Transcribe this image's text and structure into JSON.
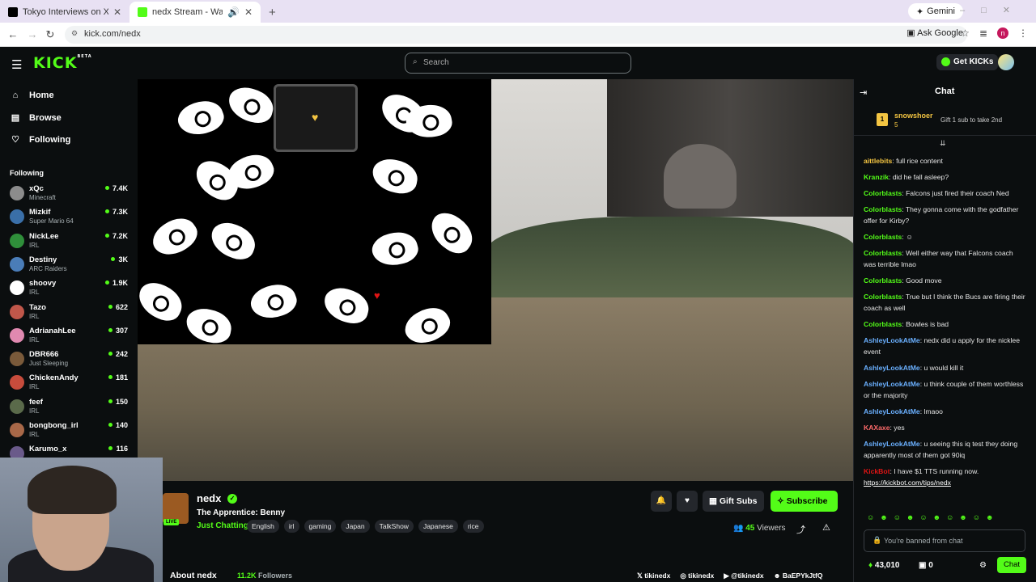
{
  "browser": {
    "tabs": [
      {
        "title": "Tokyo Interviews on X: \"@calli",
        "active": false
      },
      {
        "title": "nedx Stream - Watch Live o",
        "active": true
      }
    ],
    "gemini": "Gemini",
    "url": "kick.com/nedx",
    "ask_google": "Ask Google"
  },
  "header": {
    "logo": "KICK",
    "logo_badge": "BETA",
    "search_placeholder": "Search",
    "get_kicks": "Get KICKs"
  },
  "sidebar": {
    "nav": [
      "Home",
      "Browse",
      "Following"
    ],
    "following_heading": "Following",
    "channels": [
      {
        "name": "xQc",
        "category": "Minecraft",
        "viewers": "7.4K",
        "color": "#8c8c8c"
      },
      {
        "name": "Mizkif",
        "category": "Super Mario 64",
        "viewers": "7.3K",
        "color": "#3a6fa8"
      },
      {
        "name": "NickLee",
        "category": "IRL",
        "viewers": "7.2K",
        "color": "#2f8f3a"
      },
      {
        "name": "Destiny",
        "category": "ARC Raiders",
        "viewers": "3K",
        "color": "#4a7db8"
      },
      {
        "name": "shoovy",
        "category": "IRL",
        "viewers": "1.9K",
        "color": "#ffffff"
      },
      {
        "name": "Tazo",
        "category": "IRL",
        "viewers": "622",
        "color": "#c0574a"
      },
      {
        "name": "AdrianahLee",
        "category": "IRL",
        "viewers": "307",
        "color": "#e089b0"
      },
      {
        "name": "DBR666",
        "category": "Just Sleeping",
        "viewers": "242",
        "color": "#7a5a3a"
      },
      {
        "name": "ChickenAndy",
        "category": "IRL",
        "viewers": "181",
        "color": "#c74c3c"
      },
      {
        "name": "feef",
        "category": "IRL",
        "viewers": "150",
        "color": "#5a6a4a"
      },
      {
        "name": "bongbong_irl",
        "category": "IRL",
        "viewers": "140",
        "color": "#a86848"
      },
      {
        "name": "Karumo_x",
        "category": "",
        "viewers": "116",
        "color": "#6a5a8a"
      }
    ]
  },
  "stream": {
    "name": "nedx",
    "live": "LIVE",
    "title": "The Apprentice: Benny",
    "category": "Just Chatting",
    "tags": [
      "English",
      "irl",
      "gaming",
      "Japan",
      "TalkShow",
      "Japanese",
      "rice"
    ],
    "gift_subs": "Gift Subs",
    "subscribe": "Subscribe",
    "viewers_count": "45",
    "viewers_label": "Viewers",
    "about": "About nedx",
    "followers_count": "11.2K",
    "followers_label": "Followers",
    "socials": [
      "tikinedx",
      "tikinedx",
      "@tikinedx",
      "BaEPYkJtfQ"
    ]
  },
  "chat": {
    "title": "Chat",
    "pinned": {
      "rank": "1",
      "name": "snowshoer",
      "sub": "5",
      "gift": "Gift 1 sub to take 2nd"
    },
    "messages": [
      {
        "user": "aittlebits",
        "color": "#f4c542",
        "text": "full rice content"
      },
      {
        "user": "Kranzik",
        "color": "#53fc18",
        "text": "did he fall asleep?"
      },
      {
        "user": "Colorblasts",
        "color": "#53fc18",
        "text": "Falcons just fired their coach Ned"
      },
      {
        "user": "Colorblasts",
        "color": "#53fc18",
        "text": "They gonna come with the godfather offer for Kirby?"
      },
      {
        "user": "Colorblasts",
        "color": "#53fc18",
        "text": "☺"
      },
      {
        "user": "Colorblasts",
        "color": "#53fc18",
        "text": "Well either way that Falcons coach was terrible lmao"
      },
      {
        "user": "Colorblasts",
        "color": "#53fc18",
        "text": "Good move"
      },
      {
        "user": "Colorblasts",
        "color": "#53fc18",
        "text": "True but I think the Bucs are firing their coach as well"
      },
      {
        "user": "Colorblasts",
        "color": "#53fc18",
        "text": "Bowles is bad"
      },
      {
        "user": "AshleyLookAtMe",
        "color": "#6ab0ff",
        "text": "nedx did u apply for the nicklee event"
      },
      {
        "user": "AshleyLookAtMe",
        "color": "#6ab0ff",
        "text": "u would kill it"
      },
      {
        "user": "AshleyLookAtMe",
        "color": "#6ab0ff",
        "text": "u think couple of them worthless or the majority"
      },
      {
        "user": "AshleyLookAtMe",
        "color": "#6ab0ff",
        "text": "lmaoo"
      },
      {
        "user": "KAXaxe",
        "color": "#ff6b6b",
        "text": "yes"
      },
      {
        "user": "AshleyLookAtMe",
        "color": "#6ab0ff",
        "text": "u seeing this iq test they doing apparently most of them got 90iq"
      },
      {
        "user": "KickBot",
        "color": "#e01414",
        "text": "I have $1 TTS running now.",
        "link": "https://kickbot.com/tips/nedx"
      }
    ],
    "input_placeholder": "You're banned from chat",
    "kicks_count": "43,010",
    "box_count": "0",
    "chat_button": "Chat"
  },
  "colors": {
    "accent": "#53fc18",
    "bg": "#0b0e0f",
    "panel": "#24272c"
  }
}
